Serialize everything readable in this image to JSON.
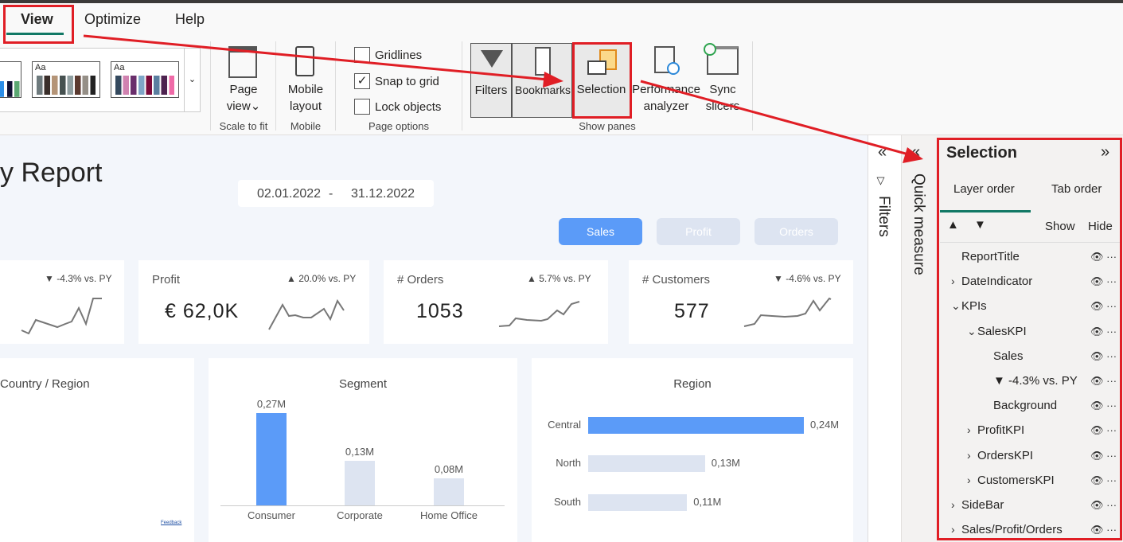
{
  "tabs": [
    "View",
    "Optimize",
    "Help"
  ],
  "ribbon": {
    "page_view": [
      "Page",
      "view"
    ],
    "mobile_layout": [
      "Mobile",
      "layout"
    ],
    "scale_to_fit": "Scale to fit",
    "mobile": "Mobile",
    "checkboxes": [
      {
        "label": "Gridlines",
        "checked": false
      },
      {
        "label": "Snap to grid",
        "checked": true
      },
      {
        "label": "Lock objects",
        "checked": false
      }
    ],
    "page_options": "Page options",
    "panes": [
      "Filters",
      "Bookmarks",
      "Selection"
    ],
    "perf": [
      "Performance",
      "analyzer"
    ],
    "sync": [
      "Sync",
      "slicers"
    ],
    "show_panes": "Show panes",
    "check_mark": "✓"
  },
  "report": {
    "title": "y Report",
    "date_from": "02.01.2022",
    "date_sep": "-",
    "date_to": "31.12.2022",
    "toggles": [
      "Sales",
      "Profit",
      "Orders"
    ],
    "kpis": [
      {
        "title": "",
        "delta": "▼ -4.3% vs. PY",
        "value": ""
      },
      {
        "title": "Profit",
        "delta": "▲ 20.0% vs. PY",
        "value": "€ 62,0K"
      },
      {
        "title": "# Orders",
        "delta": "▲ 5.7% vs. PY",
        "value": "1053"
      },
      {
        "title": "# Customers",
        "delta": "▼ -4.6% vs. PY",
        "value": "577"
      }
    ],
    "map_title": "Country / Region",
    "feedback": "Feedback",
    "segment_title": "Segment",
    "region_title": "Region"
  },
  "chart_data": [
    {
      "type": "bar",
      "title": "Segment",
      "categories": [
        "Consumer",
        "Corporate",
        "Home Office"
      ],
      "values": [
        0.27,
        0.13,
        0.08
      ],
      "labels": [
        "0,27M",
        "0,13M",
        "0,08M"
      ],
      "unit": "M"
    },
    {
      "type": "bar",
      "orientation": "horizontal",
      "title": "Region",
      "categories": [
        "Central",
        "North",
        "South"
      ],
      "values": [
        0.24,
        0.13,
        0.11
      ],
      "labels": [
        "0,24M",
        "0,13M",
        "0,11M"
      ],
      "unit": "M"
    }
  ],
  "colors": {
    "accent": "#5b9bf8",
    "muted": "#dde4f1",
    "red": "#e01e25",
    "teal": "#117865"
  },
  "side": {
    "filters": "Filters",
    "quick_measure": "Quick measure",
    "collapse": "«"
  },
  "selection": {
    "title": "Selection",
    "expand": "»",
    "tabs": [
      "Layer order",
      "Tab order"
    ],
    "up": "▲",
    "down": "▼",
    "show": "Show",
    "hide": "Hide",
    "items": [
      {
        "label": "ReportTitle",
        "level": 0,
        "chev": ""
      },
      {
        "label": "DateIndicator",
        "level": 0,
        "chev": "›"
      },
      {
        "label": "KPIs",
        "level": 0,
        "chev": "⌄"
      },
      {
        "label": "SalesKPI",
        "level": 1,
        "chev": "⌄"
      },
      {
        "label": "Sales",
        "level": 2,
        "chev": ""
      },
      {
        "label": "▼ -4.3% vs. PY",
        "level": 2,
        "chev": ""
      },
      {
        "label": "Background",
        "level": 2,
        "chev": ""
      },
      {
        "label": "ProfitKPI",
        "level": 1,
        "chev": "›"
      },
      {
        "label": "OrdersKPI",
        "level": 1,
        "chev": "›"
      },
      {
        "label": "CustomersKPI",
        "level": 1,
        "chev": "›"
      },
      {
        "label": "SideBar",
        "level": 0,
        "chev": "›"
      },
      {
        "label": "Sales/Profit/Orders",
        "level": 0,
        "chev": "›"
      }
    ],
    "eye": "👁 ···"
  }
}
